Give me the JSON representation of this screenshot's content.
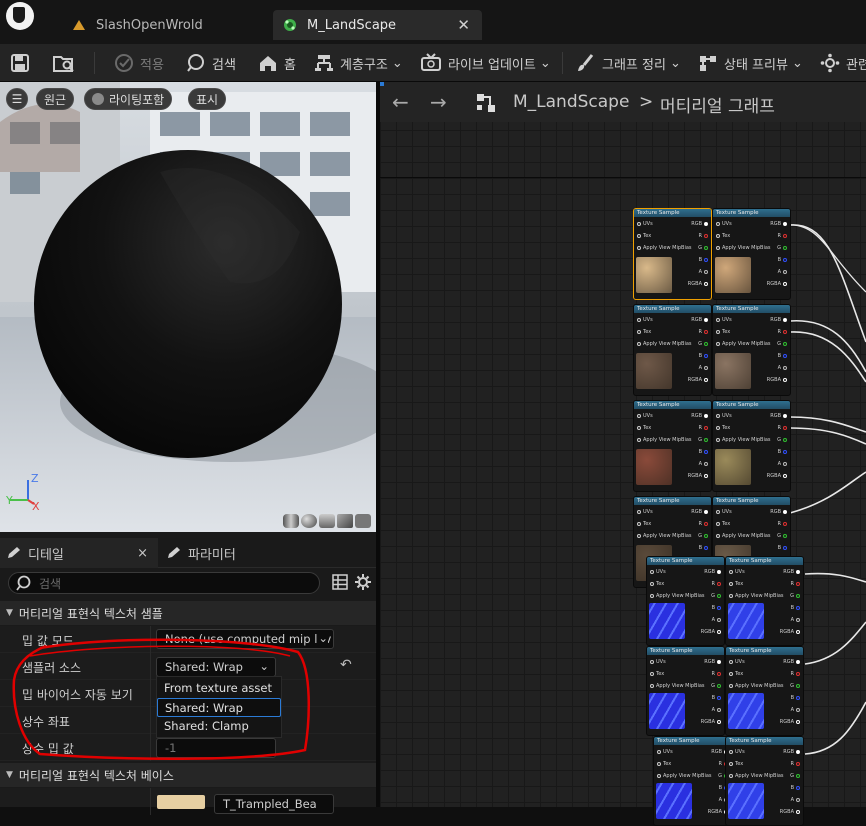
{
  "tabs": [
    {
      "label": "SlashOpenWrold",
      "icon": "material-icon"
    },
    {
      "label": "M_LandScape",
      "icon": "material-instance-icon"
    }
  ],
  "toolbar": {
    "items": [
      {
        "label": "적용",
        "icon": "apply-icon",
        "enabled": false
      },
      {
        "label": "검색",
        "icon": "search-icon"
      },
      {
        "label": "홈",
        "icon": "home-icon"
      },
      {
        "label": "계층구조",
        "icon": "hierarchy-icon",
        "dropdown": true
      },
      {
        "label": "라이브 업데이트",
        "icon": "live-update-icon",
        "dropdown": true
      },
      {
        "label": "그래프 정리",
        "icon": "brush-icon",
        "dropdown": true
      },
      {
        "label": "상태 프리뷰",
        "icon": "preview-icon",
        "dropdown": true
      },
      {
        "label": "관련",
        "icon": "settings-icon"
      }
    ]
  },
  "viewport": {
    "menu_icon": "hamburger-icon",
    "perspective_label": "원근",
    "lighting_label": "라이팅포함",
    "show_label": "표시",
    "axis_x": "X",
    "axis_y": "Y",
    "axis_z": "Z"
  },
  "details": {
    "tab_details": "디테일",
    "tab_params": "파라미터",
    "close": "×",
    "search_placeholder": "검색",
    "category1": "머티리얼 표현식 텍스처 샘플",
    "rows": [
      {
        "label": "밉 값 모드",
        "value": "None (use computed mip lev"
      },
      {
        "label": "샘플러 소스",
        "value": "Shared: Wrap"
      },
      {
        "label": "밉 바이어스 자동 보기",
        "value": ""
      },
      {
        "label": "상수 좌표",
        "value": ""
      },
      {
        "label": "상수 밉 값",
        "value": "-1"
      }
    ],
    "dropdown_options": [
      "From texture asset",
      "Shared: Wrap",
      "Shared: Clamp"
    ],
    "selected_option": "Shared: Wrap",
    "category2": "머티리얼 표현식 텍스처 베이스",
    "texture_value": "T_Trampled_Bea"
  },
  "graph": {
    "breadcrumb_root": "M_LandScape",
    "breadcrumb_sep": ">",
    "breadcrumb_current": "머티리얼 그래프",
    "node_title": "Texture Sample",
    "pins_in": [
      "UVs",
      "Tex",
      "Apply View MipBias"
    ],
    "pins_out": [
      "RGB",
      "R",
      "G",
      "B",
      "A",
      "RGBA"
    ]
  },
  "colors": {
    "panel_bg": "#1a1a1a",
    "toolbar_bg": "#242424",
    "node_header": "#2f6f8f",
    "annotation_red": "#e00000",
    "selected_outline": "#f0a000"
  }
}
